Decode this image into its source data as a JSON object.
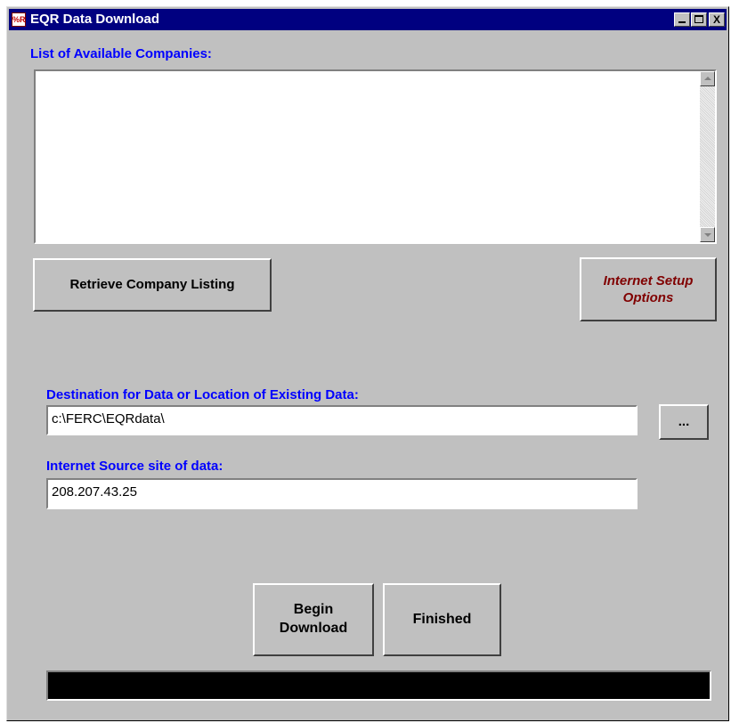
{
  "window": {
    "title": "EQR Data Download",
    "app_icon_glyph": "%R",
    "controls": {
      "minimize": "",
      "maximize": "",
      "close": "X"
    }
  },
  "companies": {
    "label": "List of Available Companies:",
    "items": []
  },
  "buttons": {
    "retrieve": "Retrieve Company Listing",
    "internet_setup": "Internet Setup\nOptions",
    "browse": "...",
    "begin_download": "Begin\nDownload",
    "finished": "Finished"
  },
  "destination": {
    "label": "Destination for Data or Location of Existing Data:",
    "value": "c:\\FERC\\EQRdata\\"
  },
  "source": {
    "label": "Internet Source site of data:",
    "value": "208.207.43.25"
  },
  "colors": {
    "label_blue": "#0000ff",
    "titlebar": "#000080",
    "internet_setup_text": "#800000",
    "progress_bar": "#000000"
  },
  "icons": [
    "app-icon",
    "minimize-icon",
    "maximize-icon",
    "close-icon",
    "scroll-up-icon",
    "scroll-down-icon"
  ]
}
